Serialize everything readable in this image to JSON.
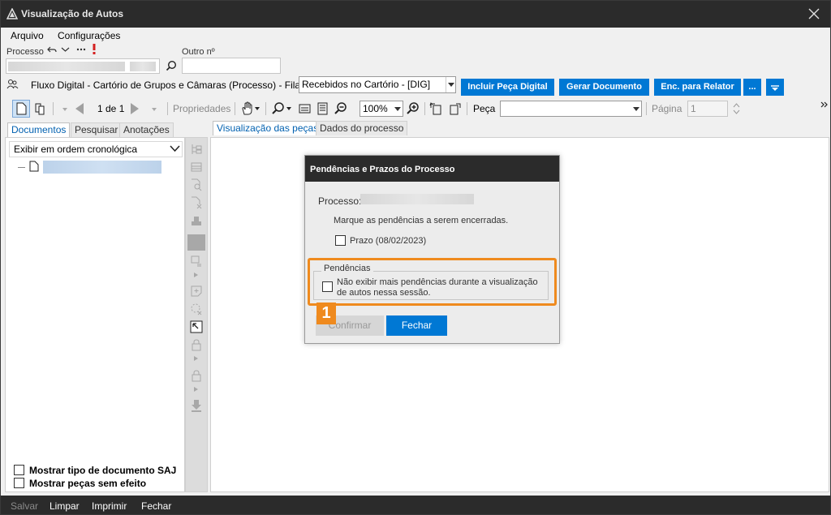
{
  "window": {
    "title": "Visualização de Autos"
  },
  "menu": {
    "items": [
      "Arquivo",
      "Configurações"
    ]
  },
  "process": {
    "label": "Processo",
    "outro_label": "Outro nº"
  },
  "flow": {
    "text": "Fluxo Digital - Cartório de Grupos e Câmaras (Processo) - Fila:",
    "queue": "Recebidos no Cartório - [DIG]",
    "buttons": [
      "Incluir Peça Digital",
      "Gerar Documento",
      "Enc. para Relator",
      "..."
    ]
  },
  "toolbar": {
    "pages": "1 de 1",
    "properties": "Propriedades",
    "zoom": "100%",
    "piece_label": "Peça",
    "page_label": "Página",
    "page_value": "1"
  },
  "left": {
    "tabs": [
      "Documentos",
      "Pesquisar",
      "Anotações"
    ],
    "order": "Exibir em ordem cronológica",
    "opt1": "Mostrar tipo de documento SAJ",
    "opt2": "Mostrar peças sem efeito"
  },
  "right": {
    "tabs": [
      "Visualização das peças",
      "Dados do processo"
    ]
  },
  "dialog": {
    "title": "Pendências e Prazos do Processo",
    "processo_label": "Processo:",
    "instruction": "Marque as pendências a serem encerradas.",
    "prazo": "Prazo (08/02/2023)",
    "group_title": "Pendências",
    "no_show_line1": "Não exibir mais pendências durante a visualização",
    "no_show_line2": "de autos nessa sessão.",
    "confirm": "Confirmar",
    "close": "Fechar"
  },
  "annotation": {
    "number": "1",
    "color": "#ef8a1e"
  },
  "status": {
    "buttons": [
      "Salvar",
      "Limpar",
      "Imprimir",
      "Fechar"
    ]
  },
  "colors": {
    "accent": "#0078d4",
    "titlebar": "#2b2b2b",
    "highlight": "#ef8a1e"
  }
}
